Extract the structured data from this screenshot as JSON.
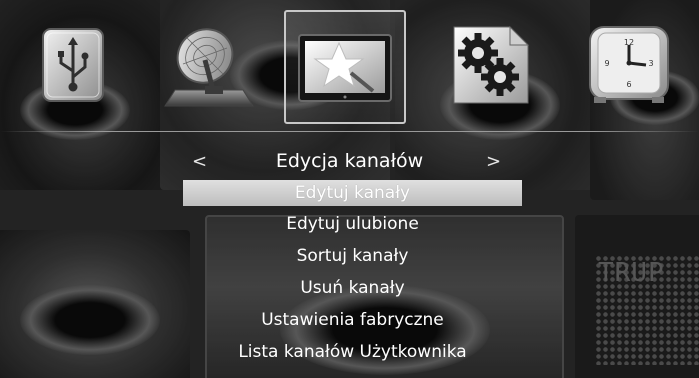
{
  "icon_bar": {
    "items": [
      {
        "icon": "usb-drive-icon"
      },
      {
        "icon": "satellite-dish-icon"
      },
      {
        "icon": "star-folder-icon",
        "selected": true
      },
      {
        "icon": "settings-gears-icon"
      },
      {
        "icon": "clock-icon"
      }
    ]
  },
  "menu": {
    "left_arrow": "<",
    "right_arrow": ">",
    "title": "Edycja kanałów",
    "items": [
      {
        "label": "Edytuj kanały",
        "selected": true
      },
      {
        "label": "Edytuj ulubione"
      },
      {
        "label": "Sortuj kanały"
      },
      {
        "label": "Usuń kanały"
      },
      {
        "label": "Ustawienia fabryczne"
      },
      {
        "label": "Lista kanałów Użytkownika"
      }
    ]
  },
  "background": {
    "ticker_text": "TRUP"
  },
  "colors": {
    "text": "#ffffff",
    "highlight": "#cfcfcf",
    "background": "#2b2b2b"
  }
}
